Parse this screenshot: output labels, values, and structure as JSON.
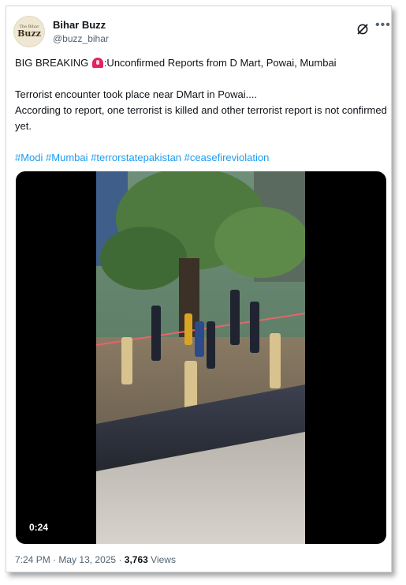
{
  "author": {
    "avatar_small_text": "The Bihar",
    "avatar_text": "Buzz",
    "name": "Bihar Buzz",
    "handle": "@buzz_bihar"
  },
  "icons": {
    "grok": "grok-icon",
    "more": "more-icon",
    "alert": "rotating-light-icon"
  },
  "post": {
    "line1_before": "BIG BREAKING ",
    "line1_after": ":Unconfirmed Reports from D Mart, Powai, Mumbai",
    "line2": "Terrorist encounter took place near DMart in Powai....",
    "line3": "According to report, one terrorist is killed and other terrorist report is not confirmed yet.",
    "hashtags": [
      "#Modi",
      "#Mumbai",
      "#terrorstatepakistan",
      "#ceasefireviolation"
    ]
  },
  "media": {
    "duration": "0:24"
  },
  "footer": {
    "time": "7:24 PM",
    "separator": "·",
    "date": "May 13, 2025",
    "separator2": "·",
    "views_count": "3,763",
    "views_label": "Views"
  },
  "colors": {
    "link": "#1d9bf0",
    "text": "#0f1419",
    "muted": "#536471",
    "border": "#cfd9de"
  }
}
